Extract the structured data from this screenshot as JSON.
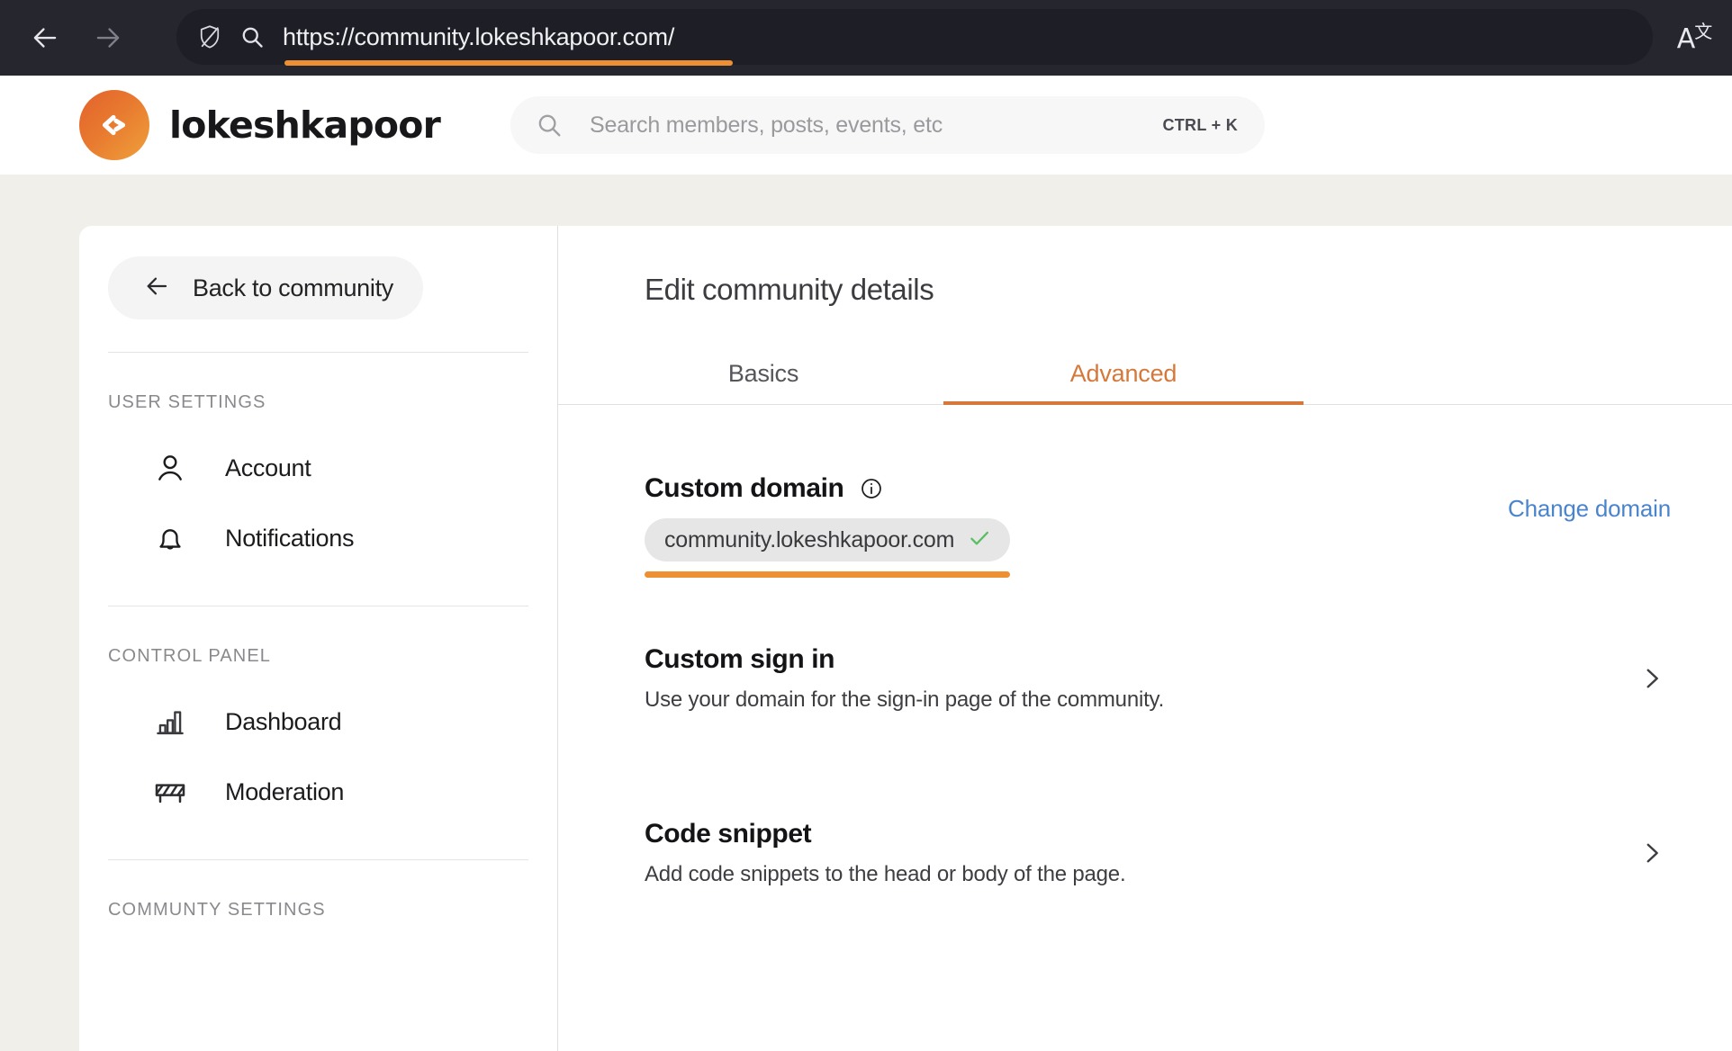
{
  "browser": {
    "back_icon": "arrow-left-icon",
    "forward_icon": "arrow-right-icon",
    "shield_icon": "shield-slash-icon",
    "search_icon": "search-icon",
    "url": "https://community.lokeshkapoor.com/",
    "translate_icon": "translate-icon",
    "url_highlight_color": "#ef8f33"
  },
  "header": {
    "logo_icon": "code-brackets-logo-icon",
    "brand": "lokeshkapoor",
    "brand_gradient_from": "#e2622c",
    "brand_gradient_to": "#efa13b",
    "search": {
      "icon": "search-icon",
      "placeholder": "Search members, posts, events, etc",
      "shortcut": "CTRL + K"
    }
  },
  "sidebar": {
    "back_button": {
      "icon": "arrow-left-icon",
      "label": "Back to community"
    },
    "sections": [
      {
        "title": "USER SETTINGS",
        "items": [
          {
            "icon": "user-icon",
            "label": "Account"
          },
          {
            "icon": "bell-icon",
            "label": "Notifications"
          }
        ]
      },
      {
        "title": "CONTROL PANEL",
        "items": [
          {
            "icon": "bar-chart-icon",
            "label": "Dashboard"
          },
          {
            "icon": "barrier-icon",
            "label": "Moderation"
          }
        ]
      },
      {
        "title": "COMMUNTY SETTINGS",
        "items": []
      }
    ]
  },
  "main": {
    "title": "Edit community details",
    "tabs": [
      {
        "label": "Basics",
        "active": false
      },
      {
        "label": "Advanced",
        "active": true
      }
    ],
    "active_tab_color": "#d4793b",
    "custom_domain": {
      "title": "Custom domain",
      "info_icon": "info-icon",
      "value": "community.lokeshkapoor.com",
      "verified_icon": "check-icon",
      "verified_color": "#5bbd62",
      "highlight_color": "#ef8f33",
      "change_link": "Change domain",
      "change_link_color": "#4a84cd"
    },
    "rows": [
      {
        "title": "Custom sign in",
        "subtitle": "Use your domain for the sign-in page of the community.",
        "chevron_icon": "chevron-right-icon"
      },
      {
        "title": "Code snippet",
        "subtitle": "Add code snippets to the head or body of the page.",
        "chevron_icon": "chevron-right-icon"
      }
    ]
  }
}
